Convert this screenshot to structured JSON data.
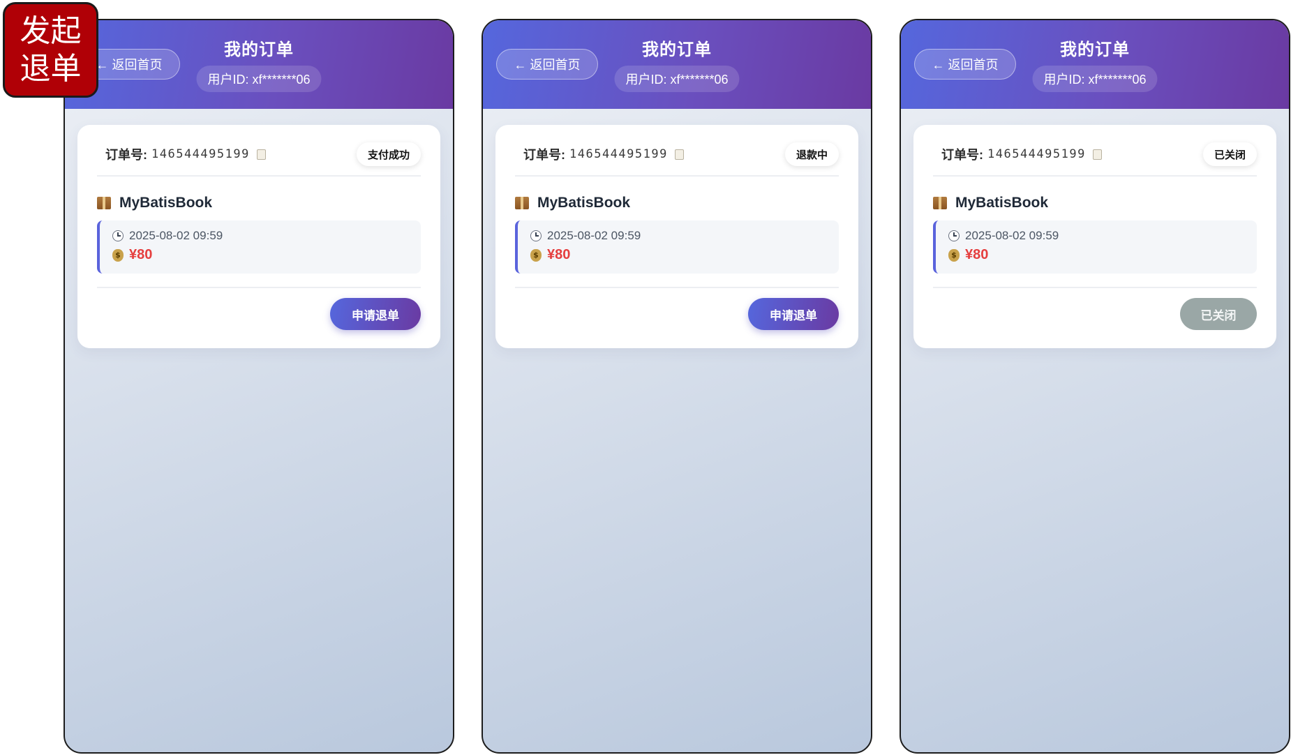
{
  "corner_label": "发起\n退单",
  "screens": [
    {
      "header": {
        "back_label": "← 返回首页",
        "title": "我的订单",
        "user_id": "用户ID: xf*******06"
      },
      "order": {
        "order_no_label": "订单号:",
        "order_no": "146544495199",
        "status": "支付成功",
        "product": "MyBatisBook",
        "time": "2025-08-02 09:59",
        "price": "¥80",
        "action": "申请退单"
      }
    },
    {
      "header": {
        "back_label": "← 返回首页",
        "title": "我的订单",
        "user_id": "用户ID: xf*******06"
      },
      "order": {
        "order_no_label": "订单号:",
        "order_no": "146544495199",
        "status": "退款中",
        "product": "MyBatisBook",
        "time": "2025-08-02 09:59",
        "price": "¥80",
        "action": "申请退单"
      }
    },
    {
      "header": {
        "back_label": "← 返回首页",
        "title": "我的订单",
        "user_id": "用户ID: xf*******06"
      },
      "order": {
        "order_no_label": "订单号:",
        "order_no": "146544495199",
        "status": "已关闭",
        "product": "MyBatisBook",
        "time": "2025-08-02 09:59",
        "price": "¥80",
        "action": "已关闭"
      }
    }
  ],
  "colors": {
    "header_start": "#5567dd",
    "header_end": "#6a3aa2",
    "price": "#e53e3e",
    "disabled_button": "#9aa7a6",
    "corner_label_bg": "#b00006"
  }
}
